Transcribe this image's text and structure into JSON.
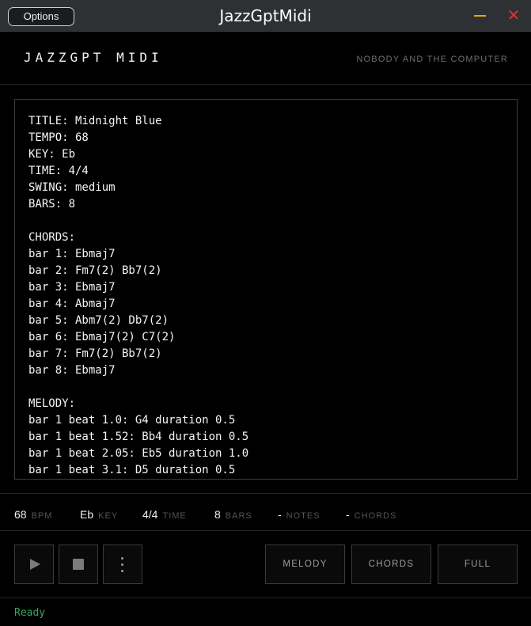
{
  "window": {
    "title": "JazzGptMidi",
    "options_label": "Options",
    "minimize_color": "#e0a71a",
    "close_color": "#e0322b"
  },
  "header": {
    "brand": "JAZZGPT MIDI",
    "tagline": "NOBODY AND THE COMPUTER"
  },
  "editor": {
    "lines": [
      "TITLE: Midnight Blue",
      "TEMPO: 68",
      "KEY: Eb",
      "TIME: 4/4",
      "SWING: medium",
      "BARS: 8",
      "",
      "CHORDS:",
      "bar 1: Ebmaj7",
      "bar 2: Fm7(2) Bb7(2)",
      "bar 3: Ebmaj7",
      "bar 4: Abmaj7",
      "bar 5: Abm7(2) Db7(2)",
      "bar 6: Ebmaj7(2) C7(2)",
      "bar 7: Fm7(2) Bb7(2)",
      "bar 8: Ebmaj7",
      "",
      "MELODY:",
      "bar 1 beat 1.0: G4 duration 0.5",
      "bar 1 beat 1.52: Bb4 duration 0.5",
      "bar 1 beat 2.05: Eb5 duration 1.0",
      "bar 1 beat 3.1: D5 duration 0.5"
    ]
  },
  "stats": {
    "bpm": {
      "value": "68",
      "label": "BPM"
    },
    "key": {
      "value": "Eb",
      "label": "KEY"
    },
    "time": {
      "value": "4/4",
      "label": "TIME"
    },
    "bars": {
      "value": "8",
      "label": "BARS"
    },
    "notes": {
      "value": "-",
      "label": "NOTES"
    },
    "chords": {
      "value": "-",
      "label": "CHORDS"
    }
  },
  "controls": {
    "play_icon": "play-icon",
    "stop_icon": "stop-icon",
    "more_icon": "more-vertical-icon",
    "melody_label": "MELODY",
    "chords_label": "CHORDS",
    "full_label": "FULL"
  },
  "status": {
    "text": "Ready",
    "color": "#37a85a"
  }
}
